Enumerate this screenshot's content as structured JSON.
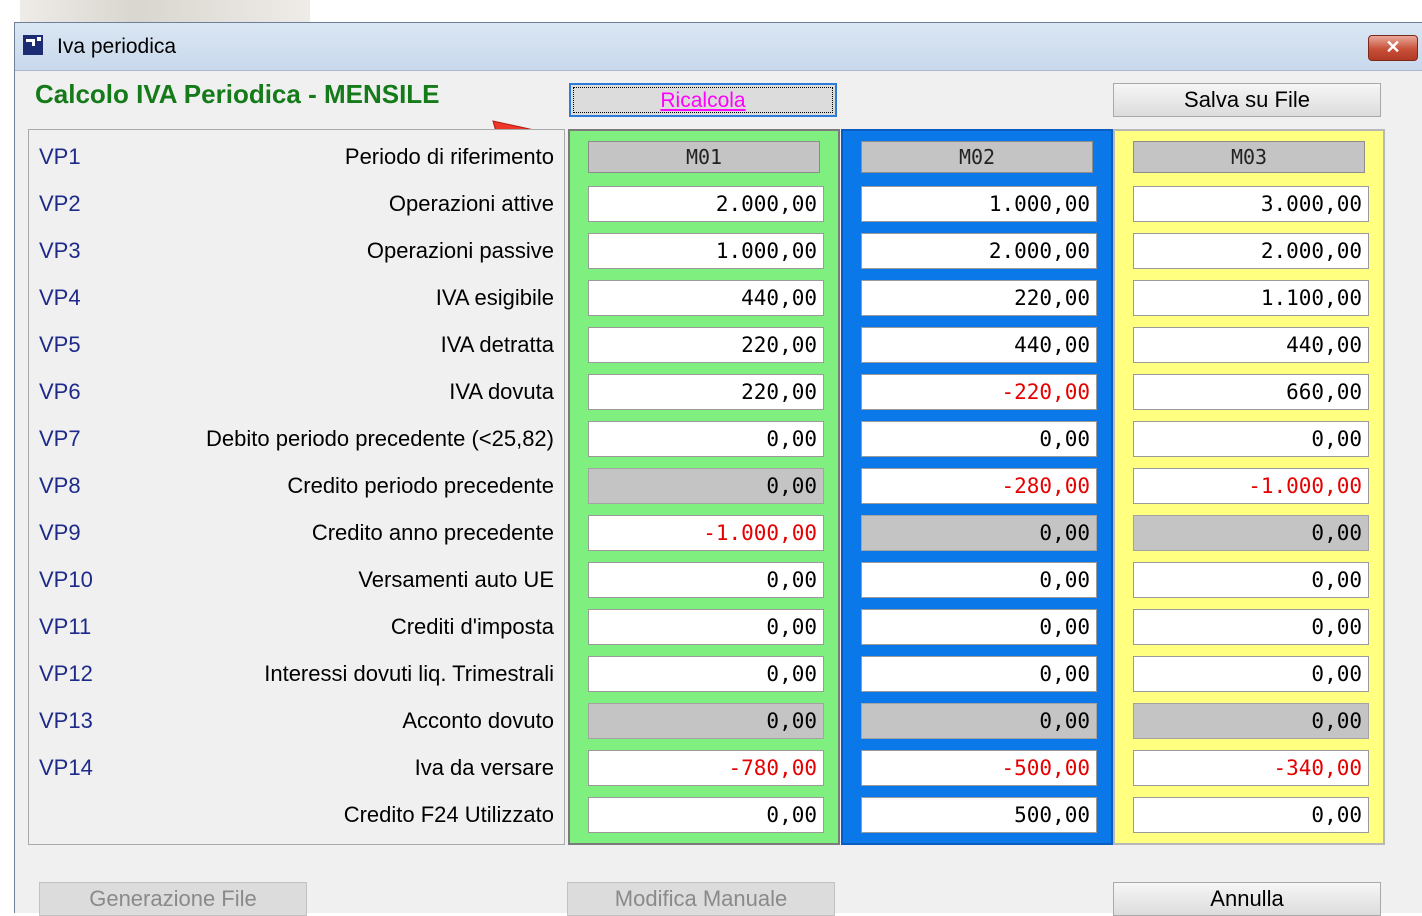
{
  "window": {
    "title": "Iva periodica",
    "close_label": "✕",
    "close_icon": "close-icon"
  },
  "heading": "Calcolo IVA Periodica - MENSILE",
  "buttons": {
    "recalc": "Ricalcola",
    "save": "Salva su  File",
    "generate": "Generazione File",
    "manual": "Modifica Manuale",
    "cancel": "Annulla"
  },
  "colors": {
    "heading": "#157a1a",
    "recalc_text": "#ff00ff",
    "m01_bg": "#7ff07f",
    "m02_bg": "#0a78e8",
    "m03_bg": "#ffff80",
    "negative": "#e60000",
    "code": "#1e2a8a"
  },
  "columns": [
    "M01",
    "M02",
    "M03"
  ],
  "rows": [
    {
      "code": "VP1",
      "label": "Periodo di riferimento",
      "header": true
    },
    {
      "code": "VP2",
      "label": "Operazioni attive",
      "values": [
        {
          "v": "2.000,00"
        },
        {
          "v": "1.000,00"
        },
        {
          "v": "3.000,00"
        }
      ]
    },
    {
      "code": "VP3",
      "label": "Operazioni passive",
      "values": [
        {
          "v": "1.000,00"
        },
        {
          "v": "2.000,00"
        },
        {
          "v": "2.000,00"
        }
      ]
    },
    {
      "code": "VP4",
      "label": "IVA esigibile",
      "values": [
        {
          "v": "440,00"
        },
        {
          "v": "220,00"
        },
        {
          "v": "1.100,00"
        }
      ]
    },
    {
      "code": "VP5",
      "label": "IVA detratta",
      "values": [
        {
          "v": "220,00"
        },
        {
          "v": "440,00"
        },
        {
          "v": "440,00"
        }
      ]
    },
    {
      "code": "VP6",
      "label": "IVA dovuta",
      "values": [
        {
          "v": "220,00"
        },
        {
          "v": "-220,00",
          "neg": true
        },
        {
          "v": "660,00"
        }
      ]
    },
    {
      "code": "VP7",
      "label": "Debito periodo precedente (<25,82)",
      "values": [
        {
          "v": "0,00"
        },
        {
          "v": "0,00"
        },
        {
          "v": "0,00"
        }
      ]
    },
    {
      "code": "VP8",
      "label": "Credito periodo precedente",
      "values": [
        {
          "v": "0,00",
          "ro": true
        },
        {
          "v": "-280,00",
          "neg": true
        },
        {
          "v": "-1.000,00",
          "neg": true
        }
      ]
    },
    {
      "code": "VP9",
      "label": "Credito anno precedente",
      "values": [
        {
          "v": "-1.000,00",
          "neg": true
        },
        {
          "v": "0,00",
          "ro": true
        },
        {
          "v": "0,00",
          "ro": true
        }
      ]
    },
    {
      "code": "VP10",
      "label": "Versamenti auto UE",
      "values": [
        {
          "v": "0,00"
        },
        {
          "v": "0,00"
        },
        {
          "v": "0,00"
        }
      ]
    },
    {
      "code": "VP11",
      "label": "Crediti d'imposta",
      "values": [
        {
          "v": "0,00"
        },
        {
          "v": "0,00"
        },
        {
          "v": "0,00"
        }
      ]
    },
    {
      "code": "VP12",
      "label": "Interessi dovuti  liq. Trimestrali",
      "values": [
        {
          "v": "0,00"
        },
        {
          "v": "0,00"
        },
        {
          "v": "0,00"
        }
      ]
    },
    {
      "code": "VP13",
      "label": "Acconto dovuto",
      "values": [
        {
          "v": "0,00",
          "ro": true
        },
        {
          "v": "0,00",
          "ro": true
        },
        {
          "v": "0,00",
          "ro": true
        }
      ]
    },
    {
      "code": "VP14",
      "label": "Iva da versare",
      "values": [
        {
          "v": "-780,00",
          "neg": true
        },
        {
          "v": "-500,00",
          "neg": true
        },
        {
          "v": "-340,00",
          "neg": true
        }
      ]
    },
    {
      "code": "",
      "label": "Credito F24 Utilizzato",
      "values": [
        {
          "v": "0,00"
        },
        {
          "v": "500,00"
        },
        {
          "v": "0,00"
        }
      ]
    }
  ]
}
